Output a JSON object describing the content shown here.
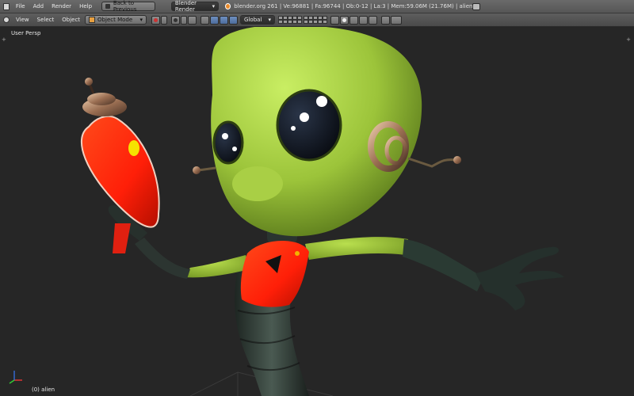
{
  "topbar": {
    "menus": [
      "File",
      "Add",
      "Render",
      "Help"
    ],
    "back_button": "Back to Previous",
    "render_engine": "Blender Render",
    "stats": "blender.org 261 | Ve:96881 | Fa:96744 | Ob:0-12 | La:3 | Mem:59.06M (21.76M) | alien"
  },
  "viewbar": {
    "menus": [
      "View",
      "Select",
      "Object"
    ],
    "mode": "Object Mode",
    "orientation": "Global"
  },
  "viewport": {
    "view_name": "User Persp",
    "object_info": "(0) alien"
  },
  "colors": {
    "alien_skin": "#9cc43a",
    "suit_red": "#ff2a0a",
    "suit_dark": "#2e3a34",
    "background": "#262626"
  }
}
